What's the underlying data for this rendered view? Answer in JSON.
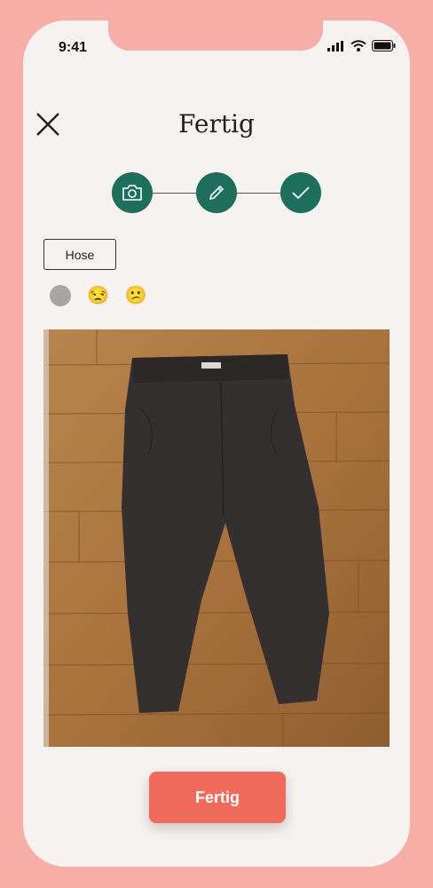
{
  "status_bar": {
    "time": "9:41"
  },
  "header": {
    "title": "Fertig"
  },
  "stepper": {
    "steps": [
      "camera-icon",
      "pencil-icon",
      "check-icon"
    ]
  },
  "item": {
    "tag_label": "Hose"
  },
  "mood": {
    "options": [
      "grey-dot",
      "😒",
      "😕"
    ]
  },
  "footer": {
    "button_label": "Fertig"
  },
  "colors": {
    "accent": "#1d6e5a",
    "cta": "#f06b5c",
    "frame": "#f6aea6",
    "screen_bg": "#f6f2f0"
  }
}
